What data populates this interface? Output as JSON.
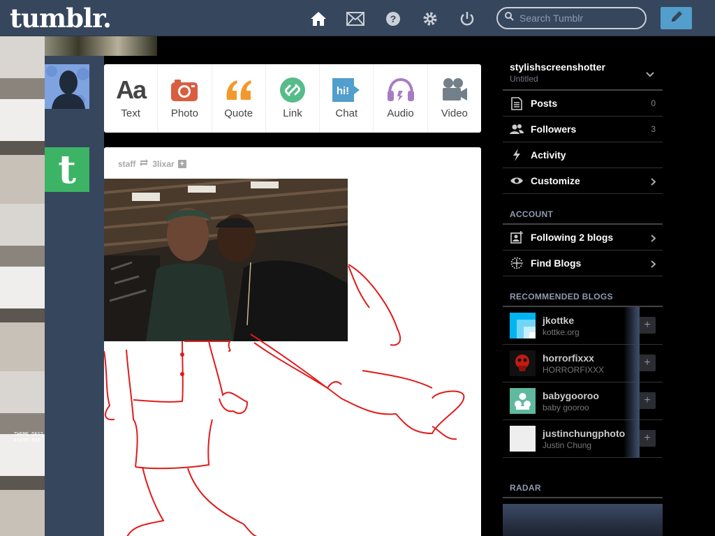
{
  "header": {
    "logo": "tumblr.",
    "search_placeholder": "Search Tumblr"
  },
  "post_types": [
    {
      "label": "Text",
      "icon": "text-icon",
      "color": "#444444"
    },
    {
      "label": "Photo",
      "icon": "camera-icon",
      "color": "#d95e40"
    },
    {
      "label": "Quote",
      "icon": "quote-icon",
      "color": "#f2992e"
    },
    {
      "label": "Link",
      "icon": "link-icon",
      "color": "#56bc8a"
    },
    {
      "label": "Chat",
      "icon": "chat-icon",
      "color": "#529ecc"
    },
    {
      "label": "Audio",
      "icon": "headphones-icon",
      "color": "#a77dc2"
    },
    {
      "label": "Video",
      "icon": "video-camera-icon",
      "color": "#748089"
    }
  ],
  "chat_bubble_text": "hi!",
  "post": {
    "author": "staff",
    "reblogged_from": "3lixar"
  },
  "background": {
    "theme_text_1": "THEME DESI",
    "theme_text_2": "FAVOR NAO"
  },
  "sidebar": {
    "blog_name": "stylishscreenshotter",
    "blog_subtitle": "Untitled",
    "items": [
      {
        "label": "Posts",
        "count": "0"
      },
      {
        "label": "Followers",
        "count": "3"
      },
      {
        "label": "Activity"
      },
      {
        "label": "Customize"
      }
    ],
    "account_title": "ACCOUNT",
    "account_items": [
      {
        "label": "Following 2 blogs"
      },
      {
        "label": "Find Blogs"
      }
    ],
    "recommended_title": "RECOMMENDED BLOGS",
    "recommended": [
      {
        "name": "jkottke",
        "url": "kottke.org"
      },
      {
        "name": "horrorfixxx",
        "url": "HORRORFIXXX"
      },
      {
        "name": "babygooroo",
        "url": "baby gooroo"
      },
      {
        "name": "justinchungphoto",
        "url": "Justin Chung"
      }
    ],
    "radar_title": "RADAR"
  },
  "colors": {
    "header_bg": "#36465d",
    "accent": "#529ecc",
    "drawing": "#e01b1b"
  }
}
